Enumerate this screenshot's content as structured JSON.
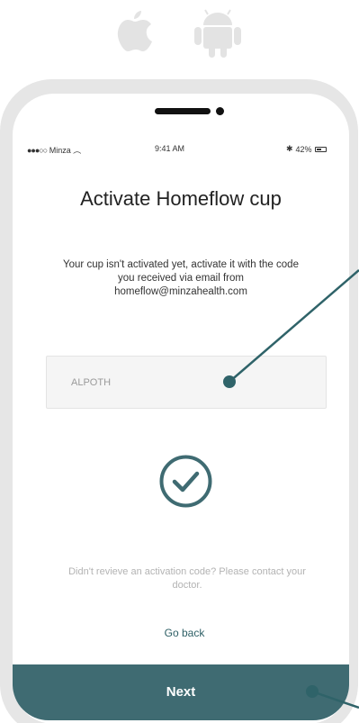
{
  "platforms": {
    "icons": [
      "apple-icon",
      "android-icon"
    ],
    "color": "#e3e3e3"
  },
  "status_bar": {
    "carrier": "Minza",
    "time": "9:41 AM",
    "battery": "42%"
  },
  "screen": {
    "title": "Activate Homeflow cup",
    "description": "Your cup isn't activated yet, activate it with the code you received via email from homeflow@minzahealth.com",
    "code_input": {
      "value": "ALPOTH"
    },
    "help_text": "Didn't revieve an activation code? Please contact your doctor.",
    "go_back_label": "Go back",
    "next_label": "Next"
  },
  "colors": {
    "accent": "#3f6b72",
    "annotation": "#2f6369"
  }
}
